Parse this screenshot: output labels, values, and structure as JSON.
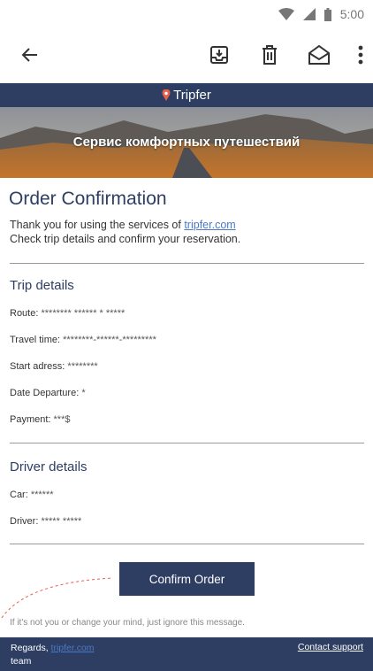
{
  "status_bar": {
    "time": "5:00",
    "icons": [
      "wifi-icon",
      "signal-icon",
      "battery-icon"
    ]
  },
  "toolbar": {
    "icons": [
      "back-arrow-icon",
      "archive-icon",
      "delete-icon",
      "mark-unread-icon",
      "more-vert-icon"
    ]
  },
  "email": {
    "brand": "Tripfer",
    "hero_tagline": "Сервис комфортных путешествий",
    "title": "Order Confirmation",
    "intro_prefix": "Thank you for using the services of ",
    "intro_link": "tripfer.com",
    "intro_line2": "Check trip details and confirm your reservation.",
    "trip_section": {
      "heading": "Trip details",
      "rows": [
        {
          "label": "Route:",
          "value": "******** ****** * *****"
        },
        {
          "label": "Travel time:",
          "value": "********-******-*********"
        },
        {
          "label": "Start adress:",
          "value": "********"
        },
        {
          "label": "Date Departure:",
          "value": "*"
        },
        {
          "label": "Payment:",
          "value": "***$"
        }
      ]
    },
    "driver_section": {
      "heading": "Driver details",
      "rows": [
        {
          "label": "Car:",
          "value": "******"
        },
        {
          "label": "Driver:",
          "value": "***** *****"
        }
      ]
    },
    "confirm_button": "Confirm Order",
    "note": "If it's not you or change your mind, just ignore this message.",
    "footer": {
      "regards_prefix": "Regards, ",
      "regards_link": "tripfer.com",
      "regards_suffix": "team",
      "contact_support": "Contact support"
    }
  },
  "colors": {
    "brand_navy": "#2d3e62",
    "link_blue": "#4a79c9",
    "hero_sky": "#a7a9ad",
    "hero_ground": "#b5651d"
  }
}
